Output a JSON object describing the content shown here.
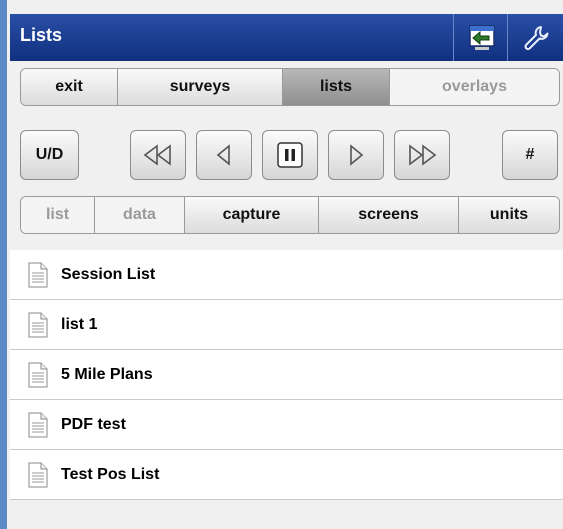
{
  "title": "Lists",
  "title_buttons": [
    {
      "name": "import-icon"
    },
    {
      "name": "wrench-icon"
    }
  ],
  "nav_tabs": [
    {
      "label": "exit",
      "state": "normal"
    },
    {
      "label": "surveys",
      "state": "normal"
    },
    {
      "label": "lists",
      "state": "selected"
    },
    {
      "label": "overlays",
      "state": "disabled"
    }
  ],
  "media_controls": {
    "ud_label": "U/D",
    "hash_label": "#",
    "icons": [
      "fast-rewind-icon",
      "step-back-icon",
      "pause-icon",
      "play-icon",
      "fast-forward-icon"
    ]
  },
  "sub_tabs": [
    {
      "label": "list",
      "state": "disabled"
    },
    {
      "label": "data",
      "state": "disabled"
    },
    {
      "label": "capture",
      "state": "normal"
    },
    {
      "label": "screens",
      "state": "normal"
    },
    {
      "label": "units",
      "state": "normal"
    }
  ],
  "list_items": [
    {
      "label": "Session List"
    },
    {
      "label": "list 1"
    },
    {
      "label": "5 Mile Plans"
    },
    {
      "label": "PDF test"
    },
    {
      "label": "Test Pos List"
    }
  ],
  "colors": {
    "titlebar": "#10307f",
    "left_edge": "#5b8ac6",
    "selected_segment": "#8f8f8f"
  }
}
